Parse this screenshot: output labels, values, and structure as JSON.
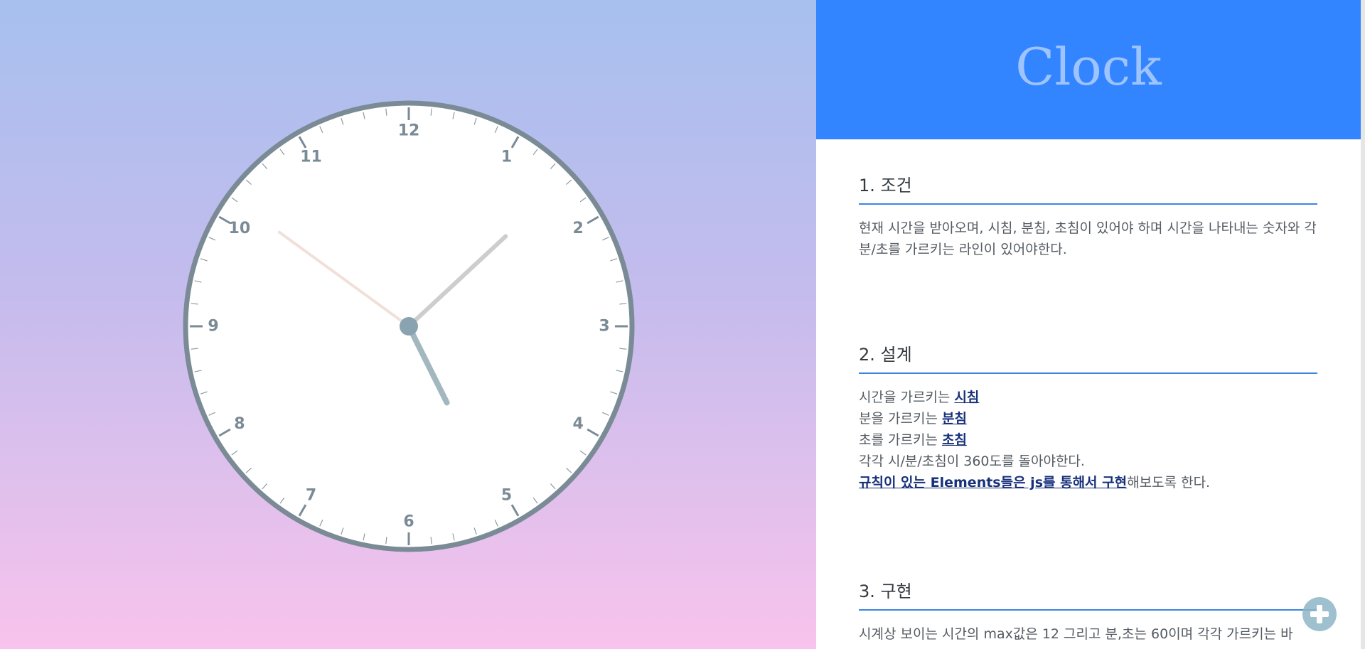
{
  "header": {
    "title": "Clock"
  },
  "clock": {
    "numbers": [
      "12",
      "1",
      "2",
      "3",
      "4",
      "5",
      "6",
      "7",
      "8",
      "9",
      "10",
      "11"
    ],
    "time": {
      "hour": 5,
      "minute": 7,
      "second": 51
    },
    "colors": {
      "face": "#ffffff",
      "rim": "#7a8b96",
      "hour_hand": "#a3b7bf",
      "minute_hand": "#cdcdcd",
      "second_hand": "#f1e0d8",
      "center": "#8aa3b0"
    }
  },
  "sections": {
    "conditions": {
      "heading": "1. 조건",
      "body": "현재 시간을 받아오며, 시침, 분침, 초침이 있어야 하며 시간을 나타내는 숫자와 각 분/초를 가르키는 라인이 있어야한다."
    },
    "design": {
      "heading": "2. 설계",
      "line1_text": "시간을 가르키는 ",
      "line1_link": "시침",
      "line2_text": "분을 가르키는 ",
      "line2_link": "분침",
      "line3_text": "초를 가르키는 ",
      "line3_link": "초침",
      "line4_text": "각각 시/분/초침이 360도를 돌아야한다.",
      "line5_link": "규칙이 있는 Elements들은 js를 통해서 구현",
      "line5_text": "해보도록 한다."
    },
    "implementation": {
      "heading": "3. 구현",
      "body": "시계상 보이는 시간의 max값은 12 그리고 분,초는 60이며 각각 가르키는 바"
    }
  },
  "fab": {
    "icon": "plus-icon"
  },
  "colors": {
    "accent": "#3384ff",
    "rule": "#3a86e0",
    "link": "#17307a"
  }
}
